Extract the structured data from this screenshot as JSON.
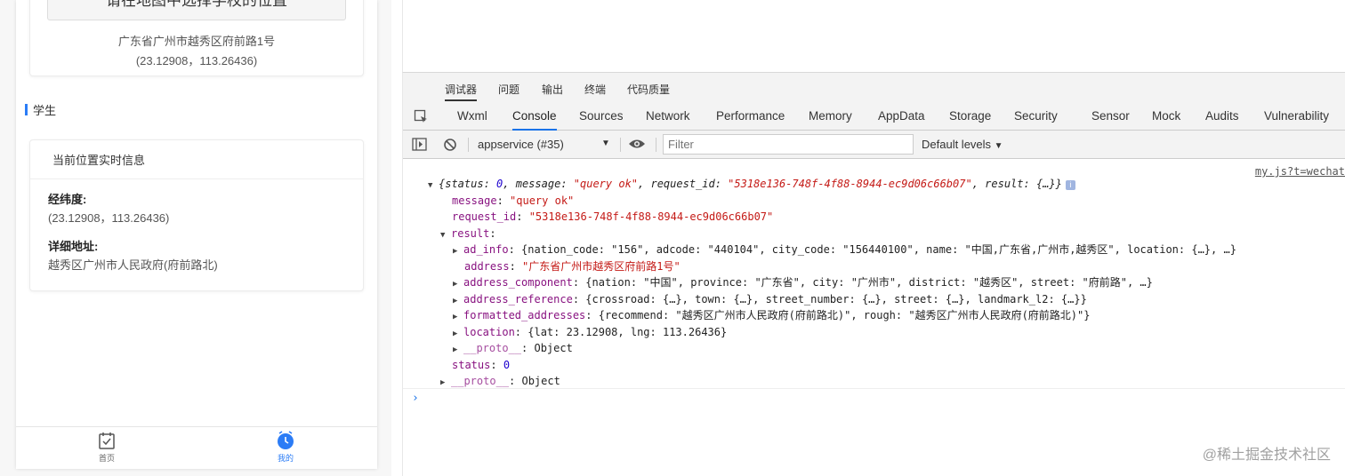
{
  "simulator": {
    "select_location_button": "请在地图中选择学校的位置",
    "school_address": "广东省广州市越秀区府前路1号",
    "school_coords": "(23.12908，113.26436)",
    "section_title": "学生",
    "info_card": {
      "title": "当前位置实时信息",
      "latlng_label": "经纬度:",
      "latlng_value": "(23.12908，113.26436)",
      "address_label": "详细地址:",
      "address_value": "越秀区广州市人民政府(府前路北)"
    },
    "tabbar": [
      {
        "label": "首页",
        "icon": "calendar-check-icon"
      },
      {
        "label": "我的",
        "icon": "clock-icon"
      }
    ]
  },
  "devtools": {
    "top_tabs": [
      "调试器",
      "问题",
      "输出",
      "终端",
      "代码质量"
    ],
    "panel_tabs": [
      "Wxml",
      "Console",
      "Sources",
      "Network",
      "Performance",
      "Memory",
      "AppData",
      "Storage",
      "Security",
      "Sensor",
      "Mock",
      "Audits",
      "Vulnerability"
    ],
    "active_panel": "Console",
    "context": "appservice (#35)",
    "filter_placeholder": "Filter",
    "levels": "Default levels",
    "source_link": "my.js?t=wechat",
    "log": {
      "summary": {
        "status_key": "status",
        "status_val": "0",
        "message_key": "message",
        "message_val": "\"query ok\"",
        "request_id_key": "request_id",
        "request_id_val": "\"5318e136-748f-4f88-8944-ec9d06c66b07\"",
        "result_key": "result",
        "result_val": "{…}"
      },
      "message": "\"query ok\"",
      "request_id": "\"5318e136-748f-4f88-8944-ec9d06c66b07\"",
      "result": {
        "ad_info": "{nation_code: \"156\", adcode: \"440104\", city_code: \"156440100\", name: \"中国,广东省,广州市,越秀区\", location: {…}, …}",
        "address": "\"广东省广州市越秀区府前路1号\"",
        "address_component": "{nation: \"中国\", province: \"广东省\", city: \"广州市\", district: \"越秀区\", street: \"府前路\", …}",
        "address_reference": "{crossroad: {…}, town: {…}, street_number: {…}, street: {…}, landmark_l2: {…}}",
        "formatted_addresses": "{recommend: \"越秀区广州市人民政府(府前路北)\", rough: \"越秀区广州市人民政府(府前路北)\"}",
        "location": "{lat: 23.12908, lng: 113.26436}",
        "proto": "Object"
      },
      "status": "0",
      "proto": "Object"
    },
    "keys": {
      "message": "message",
      "request_id": "request_id",
      "result": "result",
      "ad_info": "ad_info",
      "address": "address",
      "address_component": "address_component",
      "address_reference": "address_reference",
      "formatted_addresses": "formatted_addresses",
      "location": "location",
      "proto": "__proto__",
      "status": "status"
    },
    "prompt_symbol": "›"
  },
  "watermark": "@稀土掘金技术社区"
}
